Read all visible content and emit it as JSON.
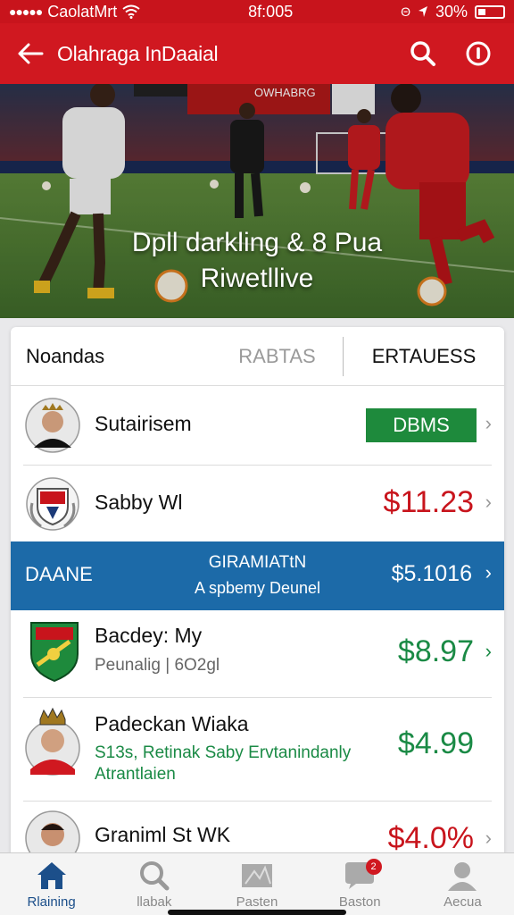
{
  "status": {
    "carrier": "CaolatMrt",
    "time": "8f:005",
    "battery": "30%",
    "bluetooth": "Θ"
  },
  "app_bar": {
    "title": "Olahraga InDaaial",
    "back_icon": "back-arrow-icon",
    "search_icon": "search-icon",
    "info_icon": "alert-icon"
  },
  "hero": {
    "caption_line1": "Dpll darkling & 8 Pua",
    "caption_line2": "Riwetllive",
    "banner_text": "OWHABRG"
  },
  "tabs": [
    {
      "label": "Noandas"
    },
    {
      "label": "RABTAS"
    },
    {
      "label": "ERTAUESS"
    }
  ],
  "rows": [
    {
      "name": "Sutairisem",
      "badge": "DBMS",
      "chevron": "›"
    },
    {
      "name": "Sabby Wl",
      "price": "$11.23",
      "price_color": "#c8141c",
      "chevron": "›"
    },
    {
      "name": "Bacdey: My",
      "sub": "Peunalig  |  6O2gl",
      "price": "$8.97",
      "price_color": "#1a8a45",
      "chevron": "›"
    },
    {
      "name": "Padeckan Wiaka",
      "sub": "S13s, Retinak Saby Ervtanindanly Atrantlaien",
      "price": "$4.99",
      "price_color": "#1a8a45"
    },
    {
      "name": "Graniml St WK",
      "price": "$4.0%",
      "price_color": "#c8141c",
      "chevron": "›"
    }
  ],
  "promo": {
    "left": "DAANE",
    "title": "GIRAMIATtN",
    "sub": "A spbemy Deunel",
    "price": "$5.1016",
    "chevron": "›"
  },
  "nav": [
    {
      "label": "Rlaining",
      "icon": "home-icon"
    },
    {
      "label": "llabak",
      "icon": "search-icon"
    },
    {
      "label": "Pasten",
      "icon": "grid-icon"
    },
    {
      "label": "Baston",
      "icon": "chat-icon",
      "badge": "2"
    },
    {
      "label": "Aecua",
      "icon": "user-icon"
    }
  ],
  "colors": {
    "brand_red": "#d01820",
    "promo_blue": "#1c6aa8",
    "green": "#1e8a3c"
  }
}
